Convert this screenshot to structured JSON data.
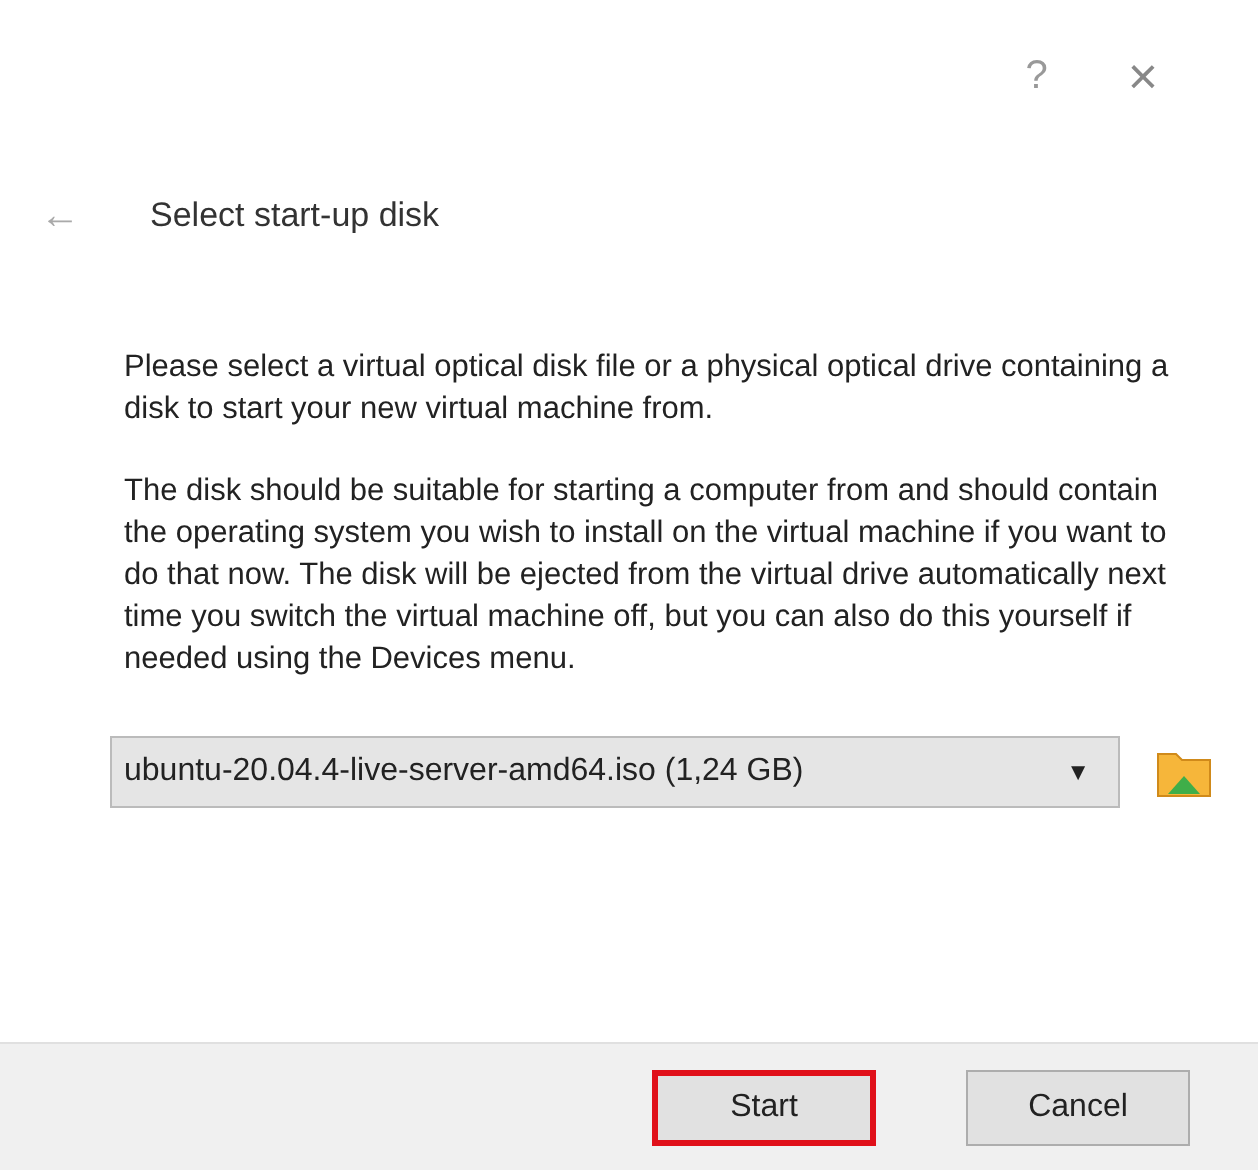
{
  "window": {
    "help": "?",
    "close": "×"
  },
  "header": {
    "back": "←",
    "title": "Select start-up disk"
  },
  "paragraphs": [
    "Please select a virtual optical disk file or a physical optical drive containing a disk to start your new virtual machine from.",
    "The disk should be suitable for starting a computer from and should contain the operating system you wish to install on the virtual machine if you want to do that now. The disk will be ejected from the virtual drive automatically next time you switch the virtual machine off, but you can also do this yourself if needed using the Devices menu."
  ],
  "disk_select": {
    "value": "ubuntu-20.04.4-live-server-amd64.iso (1,24 GB)",
    "arrow": "▼"
  },
  "buttons": [
    {
      "label": "Start",
      "highlighted": true
    },
    {
      "label": "Cancel",
      "highlighted": false
    }
  ]
}
